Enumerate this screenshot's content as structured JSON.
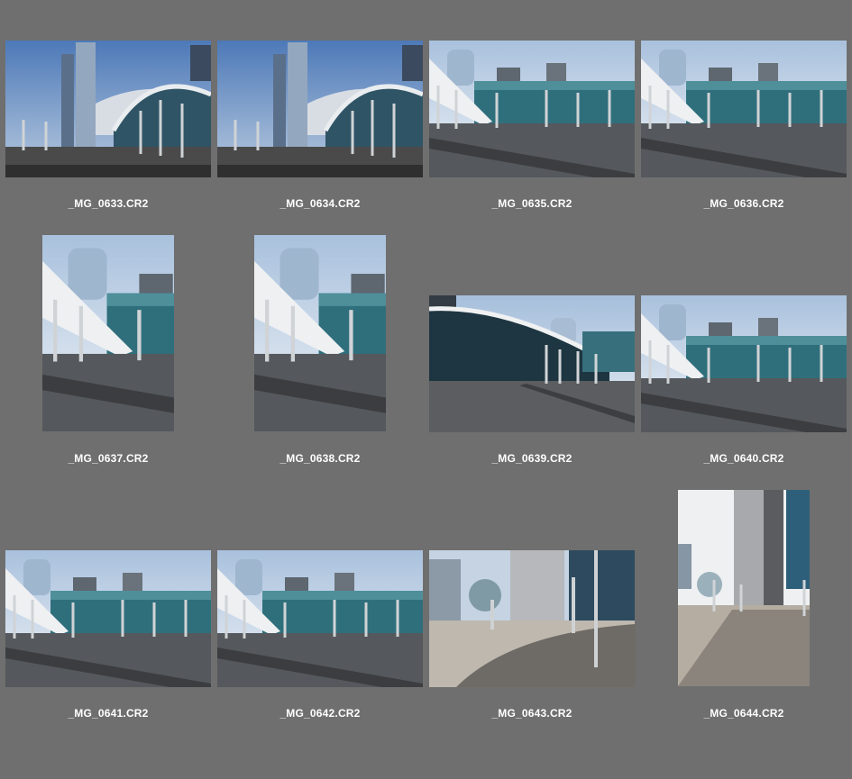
{
  "grid": {
    "items": [
      {
        "filename": "_MG_0633.CR2",
        "scene": "tower-dome",
        "orientation": "landscape"
      },
      {
        "filename": "_MG_0634.CR2",
        "scene": "tower-dome",
        "orientation": "landscape"
      },
      {
        "filename": "_MG_0635.CR2",
        "scene": "plaza-glass",
        "orientation": "landscape"
      },
      {
        "filename": "_MG_0636.CR2",
        "scene": "plaza-glass",
        "orientation": "landscape"
      },
      {
        "filename": "_MG_0637.CR2",
        "scene": "plaza-glass",
        "orientation": "portrait"
      },
      {
        "filename": "_MG_0638.CR2",
        "scene": "plaza-glass",
        "orientation": "portrait"
      },
      {
        "filename": "_MG_0639.CR2",
        "scene": "glass-curve",
        "orientation": "landscape"
      },
      {
        "filename": "_MG_0640.CR2",
        "scene": "plaza-glass",
        "orientation": "landscape"
      },
      {
        "filename": "_MG_0641.CR2",
        "scene": "plaza-glass",
        "orientation": "landscape"
      },
      {
        "filename": "_MG_0642.CR2",
        "scene": "plaza-glass",
        "orientation": "landscape"
      },
      {
        "filename": "_MG_0643.CR2",
        "scene": "street-shadow",
        "orientation": "landscape"
      },
      {
        "filename": "_MG_0644.CR2",
        "scene": "street-bright",
        "orientation": "portrait"
      }
    ]
  },
  "colors": {
    "background": "#6f6f6f",
    "caption": "#ffffff"
  }
}
